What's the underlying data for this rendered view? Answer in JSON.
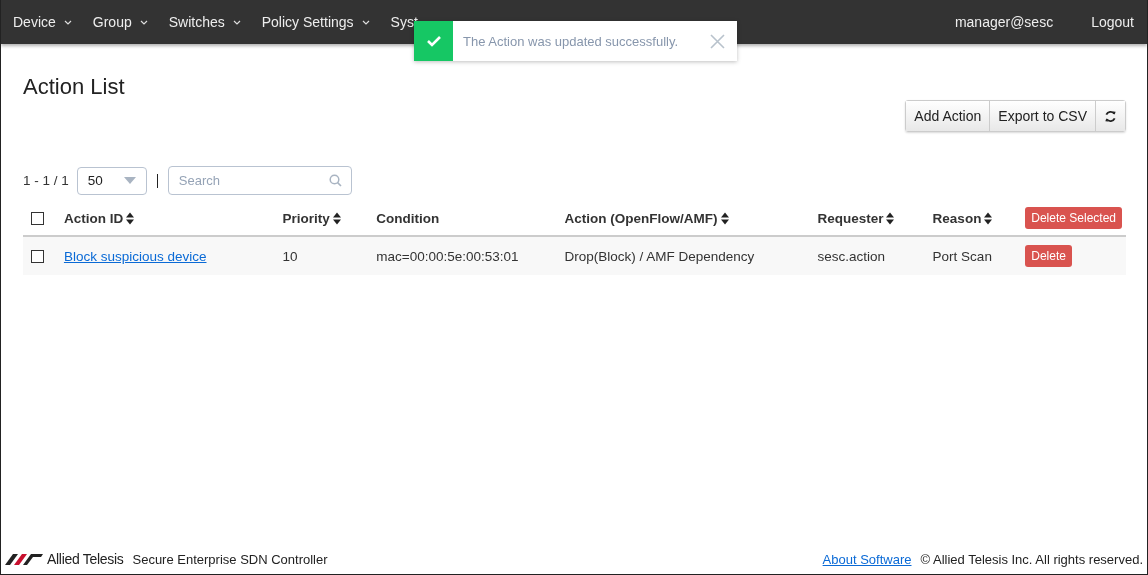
{
  "nav": {
    "items": [
      {
        "label": "Device",
        "caret": true
      },
      {
        "label": "Group",
        "caret": true
      },
      {
        "label": "Switches",
        "caret": true
      },
      {
        "label": "Policy Settings",
        "caret": true
      },
      {
        "label": "Syst",
        "caret": false
      }
    ],
    "user": "manager@sesc",
    "logout": "Logout"
  },
  "toast": {
    "kind": "success",
    "message": "The Action was updated successfully."
  },
  "page_title": "Action List",
  "toolbar": {
    "buttons": [
      "Add Action",
      "Export to CSV"
    ]
  },
  "pager": {
    "range": "1 - 1 / 1",
    "page_size": "50",
    "search": {
      "placeholder": "Search"
    }
  },
  "table": {
    "columns": [
      {
        "label": "Action ID",
        "sortable": true
      },
      {
        "label": "Priority",
        "sortable": true
      },
      {
        "label": "Condition",
        "sortable": false
      },
      {
        "label": "Action (OpenFlow/AMF)",
        "sortable": true
      },
      {
        "label": "Requester",
        "sortable": true
      },
      {
        "label": "Reason",
        "sortable": true
      }
    ],
    "delete_selected": "Delete Selected",
    "all_checked": false,
    "rows": [
      {
        "checked": false,
        "cells": [
          "Block suspicious device",
          "10",
          "mac=00:00:5e:00:53:01",
          "Drop(Block) / AMF Dependency",
          "sesc.action",
          "Port Scan"
        ],
        "delete": "Delete"
      }
    ]
  },
  "footer": {
    "brand": "Allied Telesis",
    "product": "Secure Enterprise SDN Controller",
    "link": "About Software",
    "copyright": "© Allied Telesis Inc. All rights reserved."
  }
}
